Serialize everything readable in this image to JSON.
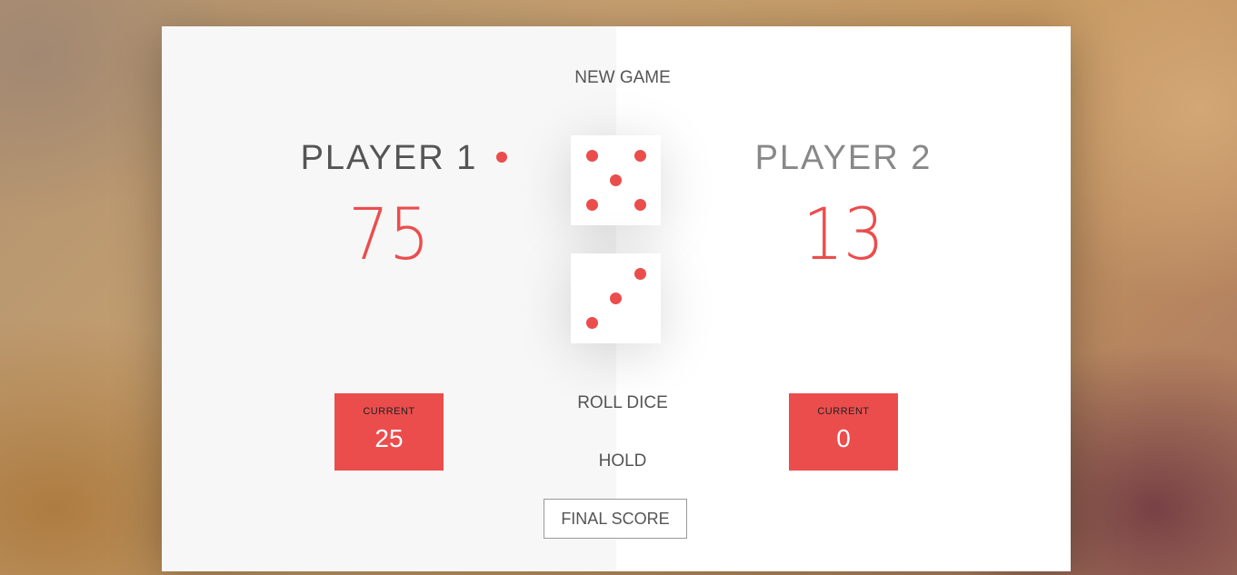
{
  "controls": {
    "new_game_label": "NEW GAME",
    "roll_dice_label": "ROLL DICE",
    "hold_label": "HOLD",
    "final_score_placeholder": "FINAL SCORE"
  },
  "players": [
    {
      "name": "PLAYER 1",
      "score": "75",
      "current_label": "CURRENT",
      "current_score": "25",
      "active": true
    },
    {
      "name": "PLAYER 2",
      "score": "13",
      "current_label": "CURRENT",
      "current_score": "0",
      "active": false
    }
  ],
  "dice": [
    {
      "value": 5
    },
    {
      "value": 3
    }
  ],
  "colors": {
    "accent": "#eb4d4d",
    "panel_left": "#f7f7f7",
    "panel_right": "#ffffff"
  }
}
